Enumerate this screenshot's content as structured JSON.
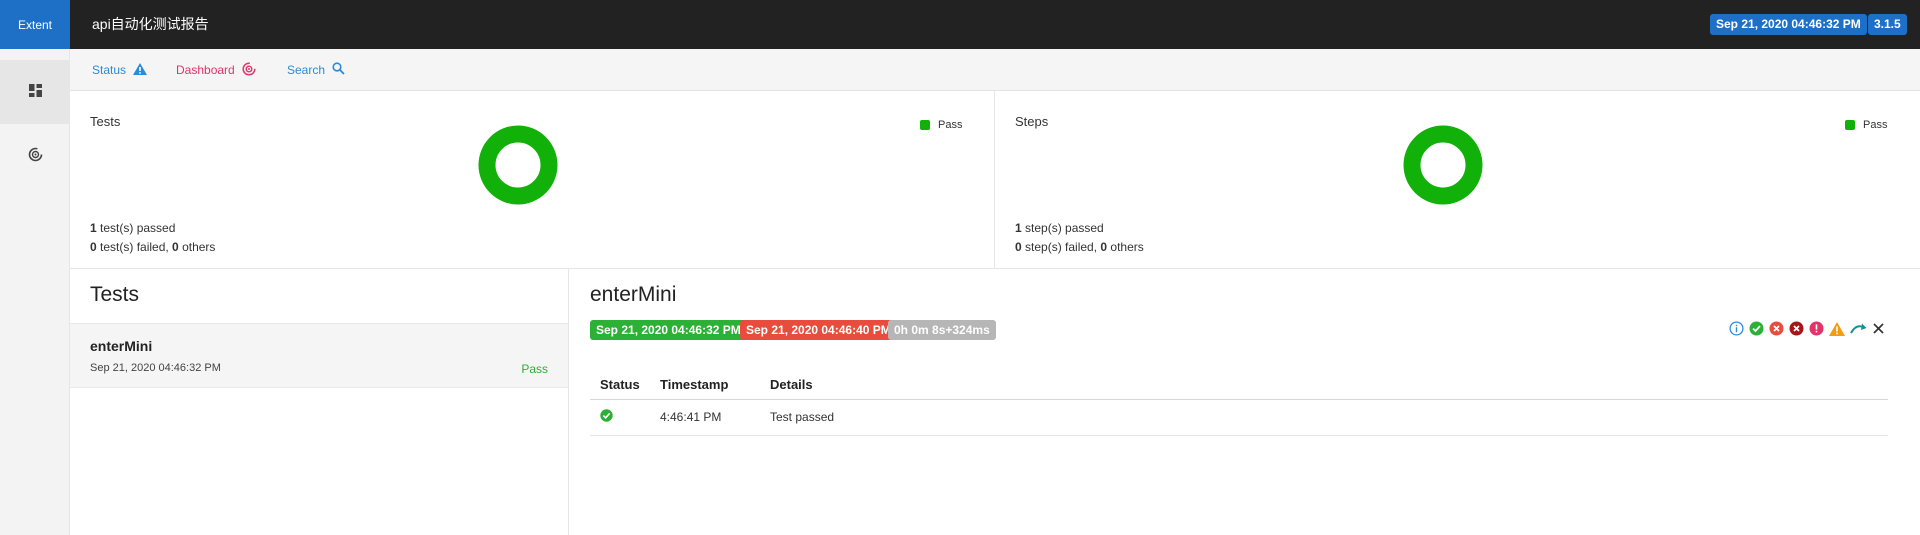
{
  "header": {
    "brand": "Extent",
    "title": "api自动化测试报告",
    "date_badge": "Sep 21, 2020 04:46:32 PM",
    "version_badge": "3.1.5"
  },
  "sidebar": {
    "items": [
      {
        "icon": "dashboard-grid-icon",
        "active": true
      },
      {
        "icon": "dashboard-gauge-icon",
        "active": false
      }
    ]
  },
  "subnav": {
    "status_label": "Status",
    "dashboard_label": "Dashboard",
    "search_label": "Search"
  },
  "colors": {
    "pass": "#12b10a",
    "fail": "#e74c3c",
    "accent": "#1e6fc6",
    "topbar": "#222222"
  },
  "dashboard": {
    "tests": {
      "title": "Tests",
      "legend": "Pass",
      "passed_count": "1",
      "passed_text": " test(s) passed",
      "failed_count": "0",
      "failed_text": " test(s) failed, ",
      "others_count": "0",
      "others_text": " others"
    },
    "steps": {
      "title": "Steps",
      "legend": "Pass",
      "passed_count": "1",
      "passed_text": " step(s) passed",
      "failed_count": "0",
      "failed_text": " step(s) failed, ",
      "others_count": "0",
      "others_text": " others"
    }
  },
  "test_list": {
    "heading": "Tests",
    "items": [
      {
        "name": "enterMini",
        "time": "Sep 21, 2020 04:46:32 PM",
        "status": "Pass"
      }
    ]
  },
  "detail": {
    "title": "enterMini",
    "start_time": "Sep 21, 2020 04:46:32 PM",
    "end_time": "Sep 21, 2020 04:46:40 PM",
    "duration": "0h 0m 8s+324ms",
    "filter_icons": [
      "info-icon",
      "pass-icon",
      "fail-icon",
      "fatal-icon",
      "error-icon",
      "warning-icon",
      "skip-icon",
      "clear-filter-icon"
    ],
    "columns": [
      "Status",
      "Timestamp",
      "Details"
    ],
    "logs": [
      {
        "status_icon": "check-circle-icon",
        "timestamp": "4:46:41 PM",
        "details": "Test passed"
      }
    ]
  }
}
